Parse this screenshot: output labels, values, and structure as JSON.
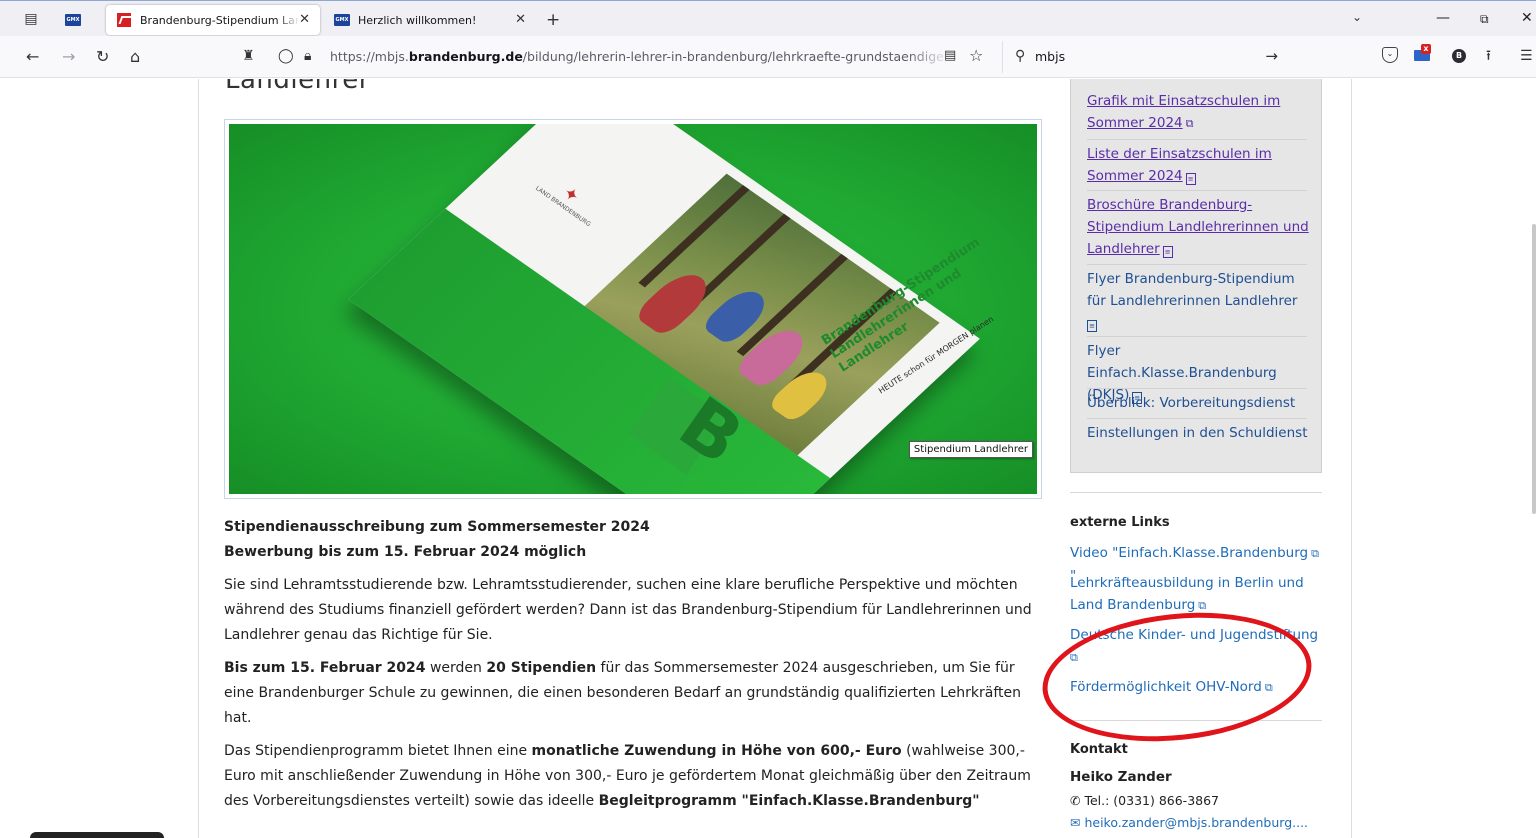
{
  "browser": {
    "tabs": [
      {
        "title": "Brandenburg-Stipendium Landlehrer",
        "active": true
      },
      {
        "title": "Herzlich willkommen!",
        "active": false
      }
    ],
    "pinned_tab_icon": "gmx-icon",
    "gmx_text": "GMX",
    "url_prefix": "https://mbjs.",
    "url_domain": "brandenburg.de",
    "url_path": "/bildung/lehrerin-lehrer-in-brandenburg/lehrkraefte-grundstaendige-ausb",
    "search_query": "mbjs",
    "mail_badge": "x",
    "profile_letter": "B"
  },
  "page": {
    "cut_heading": "Landlehrer",
    "hero": {
      "tooltip": "Stipendium Landlehrer",
      "brochure_title": "Brandenburg-Stipendium Landlehrerinnen und Landlehrer",
      "brochure_subtitle": "HEUTE schon für MORGEN planen",
      "logo_text": "LAND BRANDENBURG",
      "bildung_letter": "B"
    },
    "heading_line1": "Stipendienausschreibung zum Sommersemester 2024",
    "heading_line2": "Bewerbung bis zum 15. Februar 2024 möglich",
    "para1": "Sie sind Lehramtsstudierende bzw. Lehramtsstudierender, suchen eine klare berufliche Perspektive und möchten während des Studiums finanziell gefördert werden? Dann ist das Brandenburg-Stipendium für Landlehrerinnen und Landlehrer genau das Richtige für Sie.",
    "para2_bold1": "Bis zum 15. Februar 2024",
    "para2_text1": " werden ",
    "para2_bold2": "20 Stipendien",
    "para2_text2": " für das Sommersemester 2024 ausgeschrieben, um Sie für eine Brandenburger Schule zu gewinnen, die einen besonderen Bedarf an grundständig qualifizierten Lehrkräften hat.",
    "para3_text1": "Das Stipendienprogramm bietet Ihnen eine ",
    "para3_bold1": "monatliche Zuwendung in Höhe von 600,- Euro",
    "para3_text2": " (wahlweise 300,- Euro mit anschließender Zuwendung in Höhe von 300,- Euro je gefördertem Monat gleichmäßig über den Zeitraum des Vorbereitungsdienstes verteilt) sowie das ideelle ",
    "para3_bold2": "Begleitprogramm \"Einfach.Klasse.Brandenburg\""
  },
  "sidebar": {
    "links": [
      {
        "text": "Grafik mit Einsatzschulen im Sommer 2024",
        "icon": "external-link-icon"
      },
      {
        "text": "Liste der Einsatzschulen im Sommer 2024",
        "icon": "pdf-icon"
      },
      {
        "text": "Broschüre Brandenburg-Stipendium Landlehrerinnen und Landlehrer",
        "icon": "pdf-icon"
      },
      {
        "text": "Flyer Brandenburg-Stipendium für Landlehrerinnen Landlehrer",
        "icon": "pdf-icon"
      },
      {
        "text": "Flyer Einfach.Klasse.Brandenburg (DKJS)",
        "icon": "pdf-icon"
      },
      {
        "text": "Überblick: Vorbereitungsdienst",
        "icon": ""
      },
      {
        "text": "Einstellungen in den Schuldienst",
        "icon": ""
      }
    ],
    "external_heading": "externe Links",
    "external_links": [
      {
        "text": "Video \"Einfach.Klasse.Brandenburg",
        "suffix": "\""
      },
      {
        "text": "Lehrkräfteausbildung in Berlin und Land Brandenburg"
      },
      {
        "text": "Deutsche Kinder- und Jugendstiftung"
      },
      {
        "text": "Fördermöglichkeit OHV-Nord"
      }
    ],
    "contact_heading": "Kontakt",
    "contact_name": "Heiko Zander",
    "contact_tel": "Tel.: (0331) 866-3867",
    "contact_mail": "heiko.zander@mbjs.brandenburg...."
  },
  "colors": {
    "annotation": "#e0141b",
    "visited_link": "#5b2ca8",
    "link": "#1f6cb8",
    "hero_green": "#1ea631"
  }
}
